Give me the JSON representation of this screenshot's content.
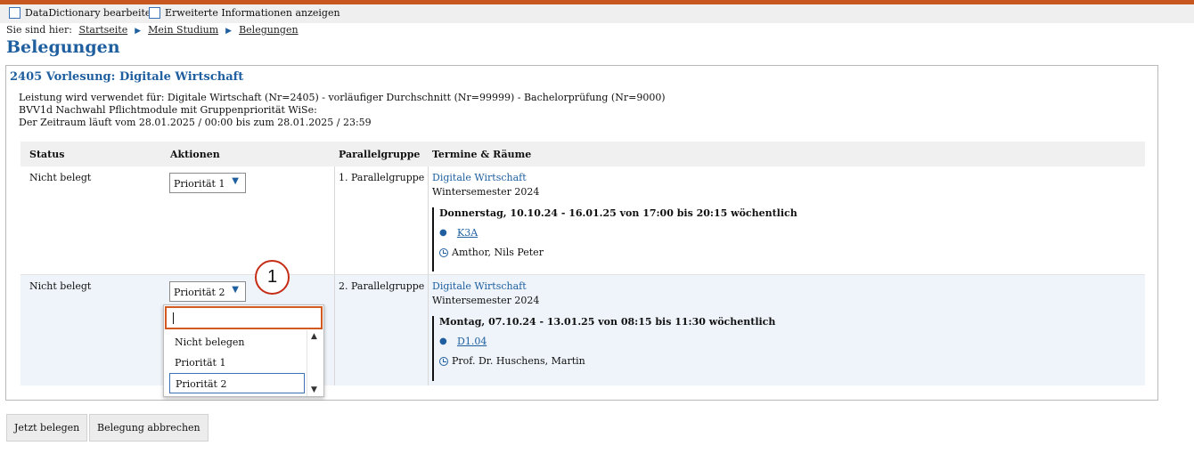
{
  "options": {
    "datadictionary_label": "DataDictionary bearbeiten",
    "erweitert_label": "Erweiterte Informationen anzeigen"
  },
  "breadcrumb": {
    "prefix": "Sie sind hier:",
    "items": [
      "Startseite",
      "Mein Studium",
      "Belegungen"
    ]
  },
  "page_title": "Belegungen",
  "course": {
    "title": "2405 Vorlesung: Digitale Wirtschaft",
    "info_lines": [
      "Leistung wird verwendet für: Digitale Wirtschaft (Nr=2405) - vorläufiger Durchschnitt (Nr=99999) - Bachelorprüfung (Nr=9000)",
      "BVV1d Nachwahl Pflichtmodule mit Gruppenpriorität WiSe:",
      "Der Zeitraum läuft vom 28.01.2025 / 00:00 bis zum 28.01.2025 / 23:59"
    ]
  },
  "table": {
    "headers": [
      "Status",
      "Aktionen",
      "Parallelgruppe",
      "Termine & Räume"
    ],
    "rows": [
      {
        "status": "Nicht belegt",
        "priority": "Priorität 1",
        "group": "1. Parallelgruppe",
        "course_link": "Digitale Wirtschaft",
        "semester": "Wintersemester 2024",
        "schedule": "Donnerstag, 10.10.24 - 16.01.25 von 17:00 bis 20:15 wöchentlich",
        "room": "K3A",
        "lecturer": "Amthor, Nils Peter"
      },
      {
        "status": "Nicht belegt",
        "priority": "Priorität 2",
        "group": "2. Parallelgruppe",
        "course_link": "Digitale Wirtschaft",
        "semester": "Wintersemester 2024",
        "schedule": "Montag, 07.10.24 - 13.01.25 von 08:15 bis 11:30 wöchentlich",
        "room": "D1.04",
        "lecturer": "Prof. Dr. Huschens, Martin"
      }
    ]
  },
  "dropdown": {
    "search_value": "",
    "options": [
      "Nicht belegen",
      "Priorität 1",
      "Priorität 2"
    ],
    "selected": "Priorität 2"
  },
  "marker_label": "1",
  "buttons": {
    "submit": "Jetzt belegen",
    "cancel": "Belegung abbrechen"
  },
  "colors": {
    "accent": "#1f5f9f",
    "topbar": "#c8561f",
    "focus": "#d2591f",
    "marker": "#c62d16"
  }
}
